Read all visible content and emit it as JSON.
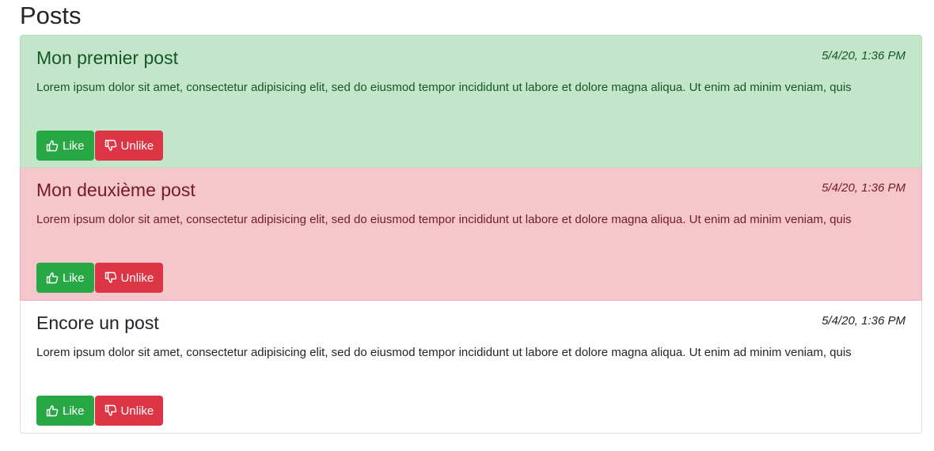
{
  "page": {
    "title": "Posts"
  },
  "posts": [
    {
      "title": "Mon premier post",
      "date": "5/4/20, 1:36 PM",
      "body": "Lorem ipsum dolor sit amet, consectetur adipisicing elit, sed do eiusmod tempor incididunt ut labore et dolore magna aliqua. Ut enim ad minim veniam, quis",
      "like_label": "Like",
      "unlike_label": "Unlike",
      "state": "success"
    },
    {
      "title": "Mon deuxième post",
      "date": "5/4/20, 1:36 PM",
      "body": "Lorem ipsum dolor sit amet, consectetur adipisicing elit, sed do eiusmod tempor incididunt ut labore et dolore magna aliqua. Ut enim ad minim veniam, quis",
      "like_label": "Like",
      "unlike_label": "Unlike",
      "state": "danger"
    },
    {
      "title": "Encore un post",
      "date": "5/4/20, 1:36 PM",
      "body": "Lorem ipsum dolor sit amet, consectetur adipisicing elit, sed do eiusmod tempor incididunt ut labore et dolore magna aliqua. Ut enim ad minim veniam, quis",
      "like_label": "Like",
      "unlike_label": "Unlike",
      "state": "default"
    }
  ],
  "icons": {
    "like": "thumbs-up-icon",
    "unlike": "thumbs-down-icon"
  },
  "colors": {
    "like": "#28a745",
    "unlike": "#dc3545",
    "success_bg": "#c3e6cb",
    "danger_bg": "#f5c6cb"
  }
}
